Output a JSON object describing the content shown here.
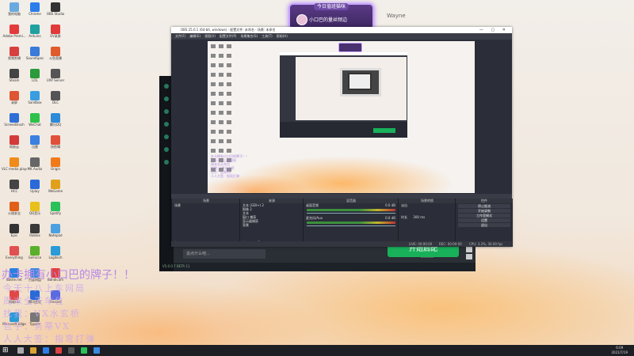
{
  "banner": {
    "title": "今日值班猫咪",
    "name": "小口巴的量丝频边"
  },
  "username": "Wayne",
  "desktop_icons": [
    {
      "label": "我的电脑",
      "color": "#6aa9e0"
    },
    {
      "label": "Chrome",
      "color": "#2b7de9"
    },
    {
      "label": "OBS Studio",
      "color": "#333333"
    },
    {
      "label": "Adobe Premi...",
      "color": "#e33b3b"
    },
    {
      "label": "Arduino",
      "color": "#21a0a0"
    },
    {
      "label": "EV录屏",
      "color": "#e03a3a"
    },
    {
      "label": "视频剪辑",
      "color": "#d84040"
    },
    {
      "label": "SoundSpec",
      "color": "#3a7ad8"
    },
    {
      "label": "斗鱼直播",
      "color": "#e05a2a"
    },
    {
      "label": "Steam",
      "color": "#444444"
    },
    {
      "label": "LOL",
      "color": "#2a9a3a"
    },
    {
      "label": "UXP Server",
      "color": "#555555"
    },
    {
      "label": "录屏",
      "color": "#dd5533"
    },
    {
      "label": "Sandbox",
      "color": "#3a9de0"
    },
    {
      "label": "DLC",
      "color": "#555555"
    },
    {
      "label": "ScreenBrush",
      "color": "#2d6fd6"
    },
    {
      "label": "WeChat",
      "color": "#2ec14a"
    },
    {
      "label": "腾讯QQ",
      "color": "#2b8bd8"
    },
    {
      "label": "网易云",
      "color": "#d43a3a"
    },
    {
      "label": "迅雷",
      "color": "#3a80e0"
    },
    {
      "label": "快剪辑",
      "color": "#e0503a"
    },
    {
      "label": "VLC media player",
      "color": "#f08a1a"
    },
    {
      "label": "MK Audio",
      "color": "#666666"
    },
    {
      "label": "Origin",
      "color": "#f07a1a"
    },
    {
      "label": "HCC",
      "color": "#444444"
    },
    {
      "label": "Uplay",
      "color": "#2a6ad8"
    },
    {
      "label": "WeGame",
      "color": "#e0a01a"
    },
    {
      "label": "火绒安全",
      "color": "#e0601a"
    },
    {
      "label": "QQ音乐",
      "color": "#e8c01a"
    },
    {
      "label": "Spotify",
      "color": "#2ac05a"
    },
    {
      "label": "Epic",
      "color": "#333333"
    },
    {
      "label": "Roblox",
      "color": "#3a3a3a"
    },
    {
      "label": "Notepad",
      "color": "#4aa0e0"
    },
    {
      "label": "Everything",
      "color": "#e05050"
    },
    {
      "label": "GeForce",
      "color": "#5ab02a"
    },
    {
      "label": "Logitech",
      "color": "#2a9ad8"
    },
    {
      "label": "Battle.net",
      "color": "#2a80e0"
    },
    {
      "label": "百度网盘",
      "color": "#3a8ae0"
    },
    {
      "label": "Bandicam",
      "color": "#e04040"
    },
    {
      "label": "网易UU",
      "color": "#e04848"
    },
    {
      "label": "腾讯会议",
      "color": "#2a6ad8"
    },
    {
      "label": "Discord",
      "color": "#5a6ae0"
    },
    {
      "label": "Microsoft Edge",
      "color": "#2a9ad8"
    },
    {
      "label": "Typora",
      "color": "#777777"
    }
  ],
  "obs": {
    "title": "OBS 25.0.1 (64-bit, windows) - 配置文件: 未命名 - 场景: 未命名",
    "menu": [
      "文件(F)",
      "编辑(E)",
      "视图(V)",
      "配置文件(P)",
      "场景集合(S)",
      "工具(T)",
      "帮助(H)"
    ],
    "docks": {
      "scenes": {
        "header": "场景",
        "items": [
          "场景"
        ]
      },
      "sources": {
        "header": "来源",
        "items": [
          "文本 (GDI+) 2",
          "图像 2",
          "文本",
          "窗口 捕获",
          "显示器捕获",
          "背景"
        ]
      },
      "mixer": {
        "header": "混音器",
        "channels": [
          {
            "name": "桌面音频",
            "level": "0.0 dB"
          },
          {
            "name": "麦克风/Aux",
            "level": "0.0 dB"
          }
        ]
      },
      "transitions": {
        "header": "场景转换",
        "type": "淡出",
        "duration_label": "时长",
        "duration": "300 ms"
      },
      "controls": {
        "header": "控件",
        "buttons": [
          "停止推流",
          "开始录制",
          "工作室模式",
          "设置",
          "退出"
        ]
      }
    },
    "status": {
      "live": "LIVE: 00:00:00",
      "rec": "REC: 00:00:00",
      "cpu": "CPU: 3.2%, 30.00 fps"
    }
  },
  "dark_app": {
    "input_placeholder": "说点什么吧...",
    "send_label": "发送",
    "version": "V5.0.0.7 BETA 11"
  },
  "start_live_label": "开始启配",
  "overlay": {
    "headline": "办卡拥有小口巴的牌子！！",
    "lines": [
      "今天十八上车网局",
      "周末全天车位",
      "找我：VX水玄桥",
      "包子：务蒂VX",
      "人人大签：指弯打弹"
    ]
  },
  "preview": {
    "lines": [
      "办卡拥有小口巴的牌子！！",
      "今天十八上车网局",
      "周末全天车位",
      "找我：VX水玄桥",
      "包子：务蒂VX",
      "人人大签：指弯打弹"
    ]
  },
  "taskbar": {
    "time": "6:09",
    "date": "2021/7/19"
  }
}
